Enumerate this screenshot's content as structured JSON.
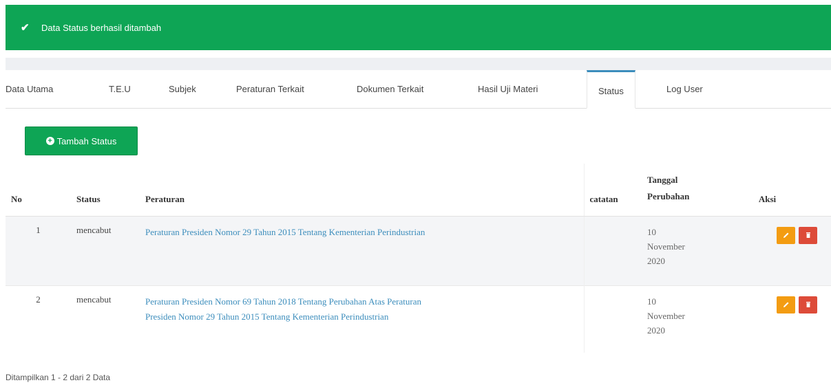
{
  "alert": {
    "icon": "check-icon",
    "text": "Data Status berhasil ditambah"
  },
  "tabs": [
    {
      "label": "Data Utama"
    },
    {
      "label": "T.E.U"
    },
    {
      "label": "Subjek"
    },
    {
      "label": "Peraturan Terkait"
    },
    {
      "label": "Dokumen Terkait"
    },
    {
      "label": "Hasil Uji Materi"
    },
    {
      "label": "Status",
      "active": true
    },
    {
      "label": "Log User"
    }
  ],
  "add_button": {
    "icon": "plus-circle-icon",
    "label": "Tambah Status"
  },
  "table": {
    "headers": {
      "no": "No",
      "status": "Status",
      "peraturan": "Peraturan",
      "catatan": "catatan",
      "tanggal_1": "Tanggal",
      "tanggal_2": "Perubahan",
      "aksi": "Aksi"
    },
    "rows": [
      {
        "no": "1",
        "status": "mencabut",
        "peraturan": "Peraturan Presiden Nomor 29 Tahun 2015 Tentang Kementerian Perindustrian",
        "catatan": "",
        "tgl_day": "10",
        "tgl_month": "November",
        "tgl_year": "2020"
      },
      {
        "no": "2",
        "status": "mencabut",
        "peraturan_l1": "Peraturan Presiden Nomor 69 Tahun 2018 Tentang Perubahan Atas Peraturan",
        "peraturan_l2": "Presiden Nomor 29 Tahun 2015 Tentang Kementerian Perindustrian",
        "catatan": "",
        "tgl_day": "10",
        "tgl_month": "November",
        "tgl_year": "2020"
      }
    ]
  },
  "footer": {
    "text": "Ditampilkan 1 - 2 dari 2 Data"
  },
  "colors": {
    "success": "#0ea555",
    "edit": "#f39c12",
    "delete": "#dd4b39",
    "link": "#3c8dbc",
    "active_tab": "#3c8dbc"
  }
}
